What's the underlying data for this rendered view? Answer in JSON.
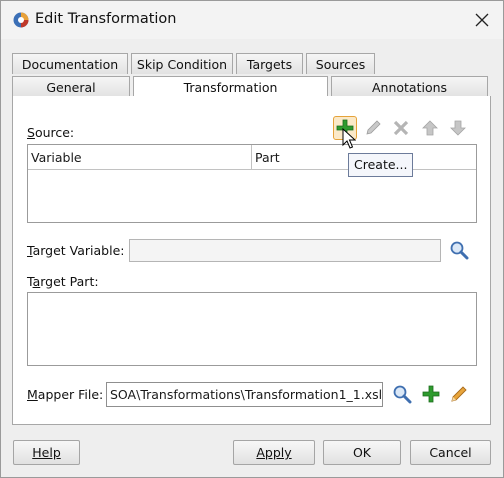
{
  "window": {
    "title": "Edit Transformation"
  },
  "tabs_row1": [
    "Documentation",
    "Skip Condition",
    "Targets",
    "Sources"
  ],
  "tabs_row2": [
    "General",
    "Transformation",
    "Annotations"
  ],
  "active_tab": "Transformation",
  "source": {
    "label": "Source:",
    "mnemonic": "S",
    "columns": [
      "Variable",
      "Part"
    ],
    "rows": []
  },
  "tooltip": "Create...",
  "target_variable": {
    "label_mnemonic": "T",
    "label_rest": "arget Variable:",
    "value": ""
  },
  "target_part": {
    "label_pre": "T",
    "label_mnemonic": "a",
    "label_rest": "rget Part:",
    "value": ""
  },
  "mapper_file": {
    "label_mnemonic": "M",
    "label_rest": "apper File:",
    "value": "SOA\\Transformations\\Transformation1_1.xsl"
  },
  "buttons": {
    "help": "Help",
    "apply": "Apply",
    "ok": "OK",
    "cancel": "Cancel"
  },
  "icons": {
    "app": "oracle-app-icon",
    "close": "close-icon",
    "add": "add-plus-icon",
    "edit": "pencil-icon",
    "delete": "delete-x-icon",
    "up": "arrow-up-icon",
    "down": "arrow-down-icon",
    "search": "magnifier-icon"
  },
  "colors": {
    "focus_border": "#e5a33a",
    "plus_green": "#2e9b2e",
    "pencil_orange": "#d88a2c"
  }
}
